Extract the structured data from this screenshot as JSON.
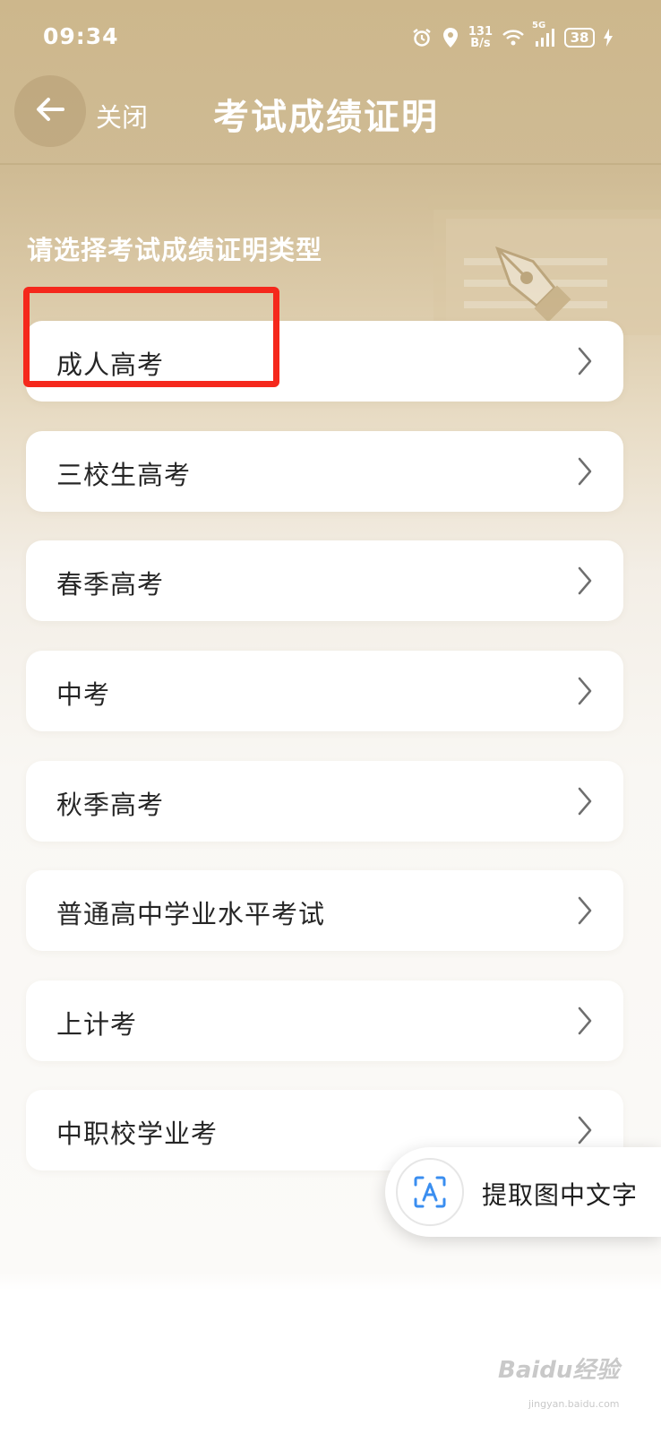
{
  "status_bar": {
    "time": "09:34",
    "net_speed_value": "131",
    "net_speed_unit": "B/s",
    "signal_label": "5G",
    "battery": "38"
  },
  "header": {
    "close_label": "关闭",
    "title": "考试成绩证明"
  },
  "prompt": "请选择考试成绩证明类型",
  "options": [
    {
      "label": "成人高考"
    },
    {
      "label": "三校生高考"
    },
    {
      "label": "春季高考"
    },
    {
      "label": "中考"
    },
    {
      "label": "秋季高考"
    },
    {
      "label": "普通高中学业水平考试"
    },
    {
      "label": "上计考"
    },
    {
      "label": "中职校学业考"
    }
  ],
  "floating_action": {
    "label": "提取图中文字",
    "icon": "text-recognition-icon"
  },
  "watermark": {
    "text": "Baidu经验",
    "url": "jingyan.baidu.com"
  },
  "colors": {
    "header_bg": "#cdb78c",
    "highlight": "#f5281c",
    "card_bg": "#ffffff",
    "text_dark": "#262626"
  }
}
